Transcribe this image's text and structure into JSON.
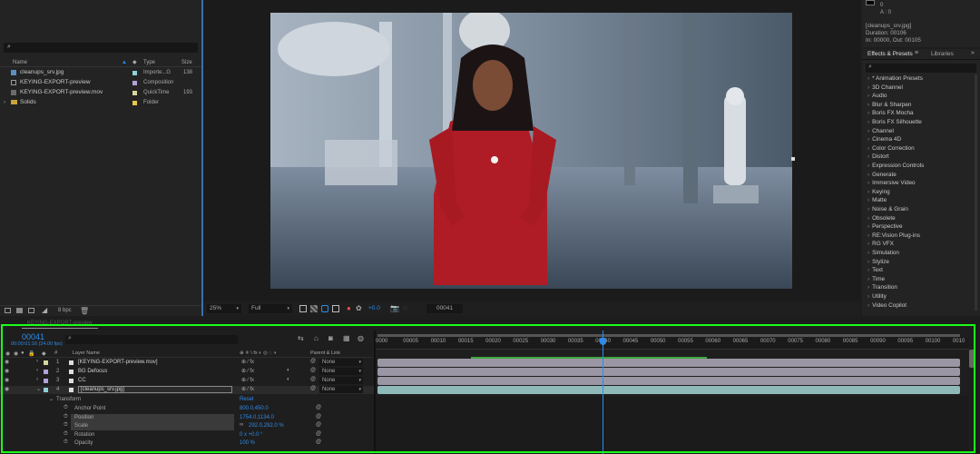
{
  "project": {
    "search_placeholder": "",
    "columns": {
      "name": "Name",
      "type": "Type",
      "size": "Size"
    },
    "items": [
      {
        "name": "cleanups_srv.jpg",
        "type": "Importe...G",
        "size": "138",
        "color": "#8fd1d9",
        "icon": "image-icon"
      },
      {
        "name": "KEYING-EXPORT-preview",
        "type": "Composition",
        "size": "",
        "color": "#b3a1d9",
        "icon": "composition-icon"
      },
      {
        "name": "KEYING-EXPORT-preview.mov",
        "type": "QuickTime",
        "size": "193",
        "color": "#d6d6a0",
        "icon": "movie-icon"
      },
      {
        "name": "Solids",
        "type": "Folder",
        "size": "",
        "color": "#e6c84a",
        "icon": "folder-icon"
      }
    ],
    "footer_bpc": "8 bpc"
  },
  "info": {
    "a_value": "A : 0",
    "b_value": "0",
    "file": "[cleanups_srv.jpg]",
    "duration": "Duration: 00106",
    "inout": "In: 00000, Out: 00105"
  },
  "viewer": {
    "zoom": "25%",
    "resolution": "Full",
    "exposure": "+0.0",
    "timecode": "00041"
  },
  "effects": {
    "tab_effects": "Effects & Presets",
    "tab_libraries": "Libraries",
    "items": [
      "* Animation Presets",
      "3D Channel",
      "Audio",
      "Blur & Sharpen",
      "Boris FX Mocha",
      "Boris FX Silhouette",
      "Channel",
      "Cinema 4D",
      "Color Correction",
      "Distort",
      "Expression Controls",
      "Generate",
      "Immersive Video",
      "Keying",
      "Matte",
      "Noise & Grain",
      "Obsolete",
      "Perspective",
      "RE:Vision Plug-ins",
      "RG VFX",
      "Simulation",
      "Stylize",
      "Text",
      "Time",
      "Transition",
      "Utility",
      "Video Copilot"
    ]
  },
  "timeline": {
    "tab_label": "KEYING-EXPORT-preview",
    "timecode": "00041",
    "fps": "00:00:01:16 (24.00 fps)",
    "search_placeholder": "",
    "col_layer_name": "Layer Name",
    "col_parent": "Parent & Link",
    "layers": [
      {
        "num": "1",
        "name": "[KEYING-EXPORT-preview.mov]",
        "parent": "None",
        "color": "#d6d6a0"
      },
      {
        "num": "2",
        "name": "BG Defocus",
        "parent": "None",
        "color": "#b3a1d9"
      },
      {
        "num": "3",
        "name": "CC",
        "parent": "None",
        "color": "#b3a1d9"
      },
      {
        "num": "4",
        "name": "[cleanups_srv.jpg]",
        "parent": "None",
        "color": "#8fd1d9"
      }
    ],
    "transform": {
      "label": "Transform",
      "reset": "Reset"
    },
    "properties": [
      {
        "name": "Anchor Point",
        "value": "800.0,450.0"
      },
      {
        "name": "Position",
        "value": "1754.0,1134.0"
      },
      {
        "name": "Scale",
        "value": "292.0,292.0 %"
      },
      {
        "name": "Rotation",
        "value": "0 x +0.0 °"
      },
      {
        "name": "Opacity",
        "value": "100 %"
      }
    ],
    "ruler": [
      "0000",
      "00005",
      "00010",
      "00015",
      "00020",
      "00025",
      "00030",
      "00035",
      "00040",
      "00045",
      "00050",
      "00055",
      "00060",
      "00065",
      "00070",
      "00075",
      "00080",
      "00085",
      "00090",
      "00095",
      "00100",
      "0010"
    ],
    "playhead_frame": 41,
    "total_frames": 106,
    "work_area": [
      0,
      106
    ],
    "cache_range": [
      17,
      60
    ]
  },
  "colors": {
    "accent": "#2d8ceb",
    "highlight_border": "#1aff1a"
  }
}
